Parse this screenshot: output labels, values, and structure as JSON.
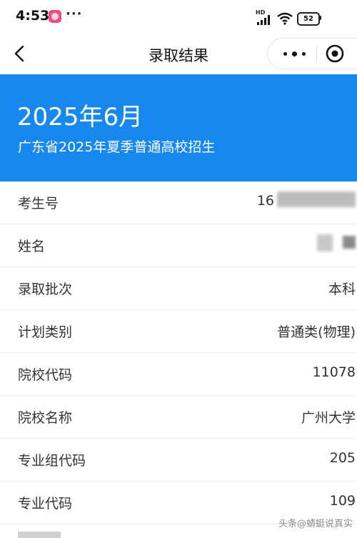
{
  "status_bar": {
    "time": "4:53",
    "dots": "···",
    "hd": "HD",
    "battery": "52"
  },
  "nav": {
    "title": "录取结果"
  },
  "banner": {
    "title": "2025年6月",
    "subtitle": "广东省2025年夏季普通高校招生",
    "color": "#1688f0"
  },
  "rows": [
    {
      "label": "考生号",
      "value": "16"
    },
    {
      "label": "姓名",
      "value": ""
    },
    {
      "label": "录取批次",
      "value": "本科"
    },
    {
      "label": "计划类别",
      "value": "普通类(物理)"
    },
    {
      "label": "院校代码",
      "value": "11078"
    },
    {
      "label": "院校名称",
      "value": "广州大学"
    },
    {
      "label": "专业组代码",
      "value": "205"
    },
    {
      "label": "专业代码",
      "value": "109"
    }
  ],
  "watermark": "头条@蜻蜓说真实"
}
